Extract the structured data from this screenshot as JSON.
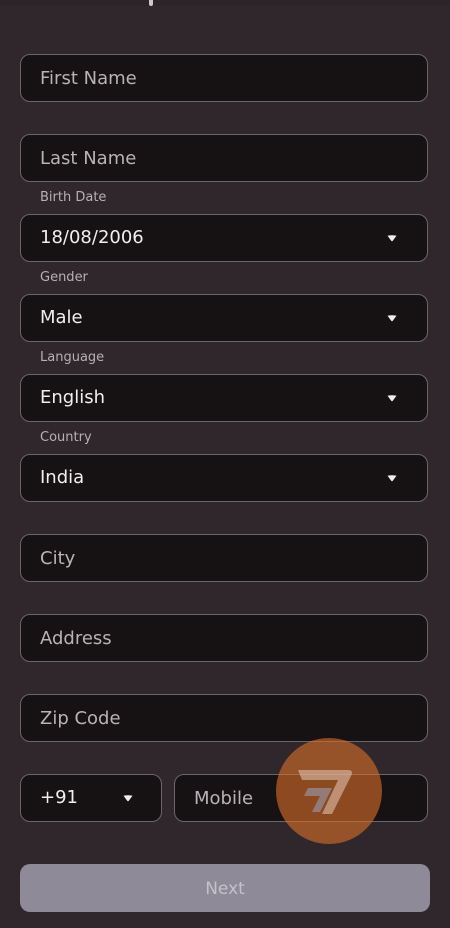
{
  "form": {
    "first_name": {
      "placeholder": "First Name"
    },
    "last_name": {
      "placeholder": "Last Name"
    },
    "birth_date": {
      "label": "Birth Date",
      "value": "18/08/2006"
    },
    "gender": {
      "label": "Gender",
      "value": "Male"
    },
    "language": {
      "label": "Language",
      "value": "English"
    },
    "country": {
      "label": "Country",
      "value": "India"
    },
    "city": {
      "placeholder": "City"
    },
    "address": {
      "placeholder": "Address"
    },
    "zip_code": {
      "placeholder": "Zip Code"
    },
    "country_code": {
      "value": "+91"
    },
    "mobile": {
      "placeholder": "Mobile"
    },
    "next_label": "Next"
  },
  "icons": {
    "dropdown": "caret-down-icon",
    "watermark": "logo-7-badge"
  },
  "colors": {
    "background": "#2f272c",
    "field_background": "#161214",
    "field_border": "#6d6469",
    "button_disabled": "#8e8a98",
    "watermark": "#d66e28"
  }
}
